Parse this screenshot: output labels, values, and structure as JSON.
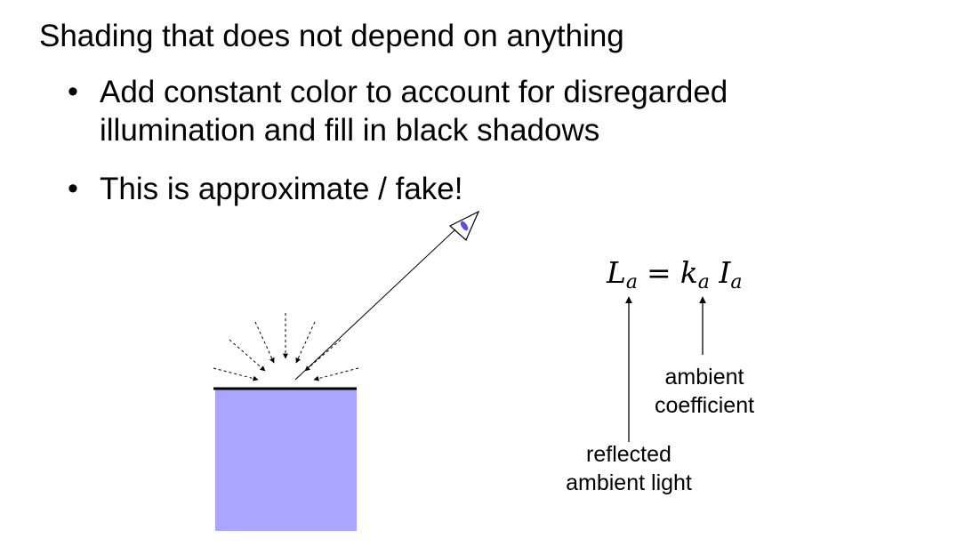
{
  "slide": {
    "title": "Shading that does not depend on anything",
    "bullets": [
      "Add constant color to account for disregarded illumination and fill in black shadows",
      "This is approximate / fake!"
    ],
    "bullet_symbol": "•"
  },
  "equation": {
    "lhs": "L",
    "lhs_sub": "a",
    "operator": "=",
    "k": "k",
    "k_sub": "a",
    "I": "I",
    "I_sub": "a"
  },
  "labels": {
    "ambient_coefficient": [
      "ambient",
      "coefficient"
    ],
    "reflected_ambient_light": [
      "reflected",
      "ambient light"
    ]
  },
  "colors": {
    "surface_fill": "#aaa6ff",
    "eye_accent": "#5a4fd8",
    "text": "#000000"
  },
  "icons": {
    "eye": "eye-icon"
  }
}
